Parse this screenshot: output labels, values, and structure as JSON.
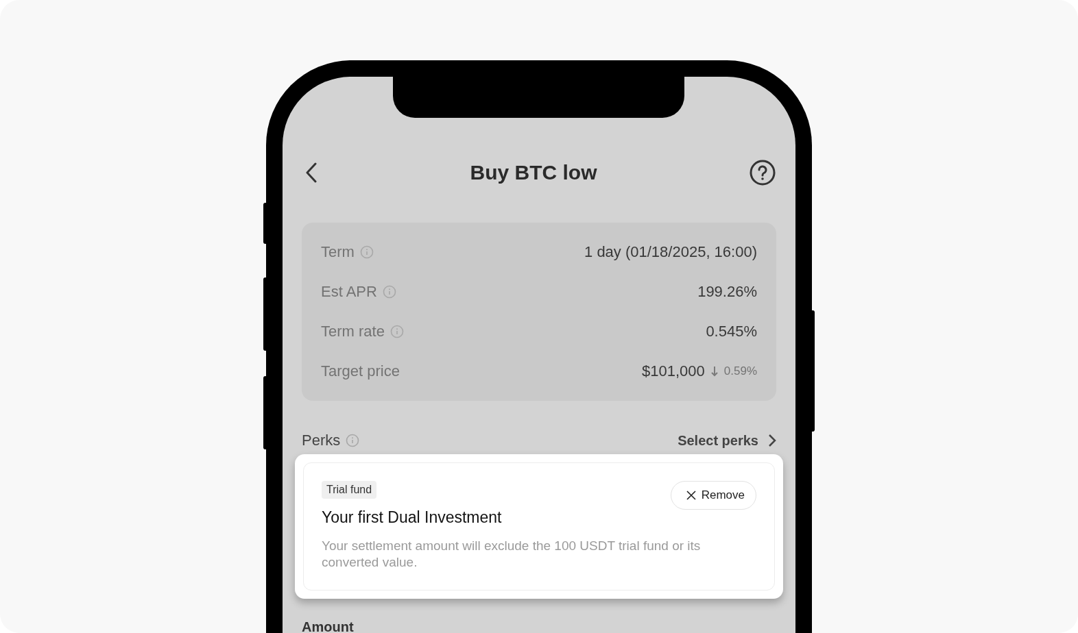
{
  "header": {
    "title": "Buy BTC low"
  },
  "details": [
    {
      "label": "Term",
      "info": true,
      "value": "1 day (01/18/2025, 16:00)"
    },
    {
      "label": "Est APR",
      "info": true,
      "value": "199.26%"
    },
    {
      "label": "Term rate",
      "info": true,
      "value": "0.545%"
    },
    {
      "label": "Target price",
      "info": false,
      "value": "$101,000",
      "change": "0.59%"
    }
  ],
  "perks": {
    "label": "Perks",
    "action": "Select perks"
  },
  "perk_card": {
    "tag": "Trial fund",
    "title": "Your first Dual Investment",
    "remove": "Remove",
    "description": "Your settlement amount will exclude the 100 USDT trial fund or its converted value."
  },
  "next_section": {
    "label": "Amount"
  }
}
